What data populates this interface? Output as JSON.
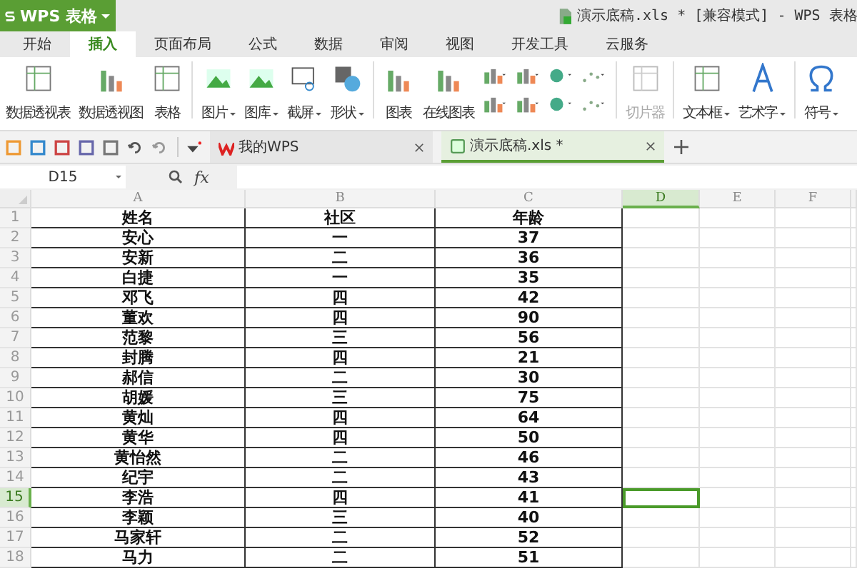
{
  "app_button": {
    "label": "WPS 表格"
  },
  "window": {
    "title": "演示底稿.xls * [兼容模式] - WPS 表格"
  },
  "tabs": [
    {
      "label": "开始",
      "selected": false
    },
    {
      "label": "插入",
      "selected": true
    },
    {
      "label": "页面布局",
      "selected": false
    },
    {
      "label": "公式",
      "selected": false
    },
    {
      "label": "数据",
      "selected": false
    },
    {
      "label": "审阅",
      "selected": false
    },
    {
      "label": "视图",
      "selected": false
    },
    {
      "label": "开发工具",
      "selected": false
    },
    {
      "label": "云服务",
      "selected": false
    }
  ],
  "ribbon": [
    {
      "kind": "large",
      "label": "数据透视表",
      "menu": false,
      "disabled": false
    },
    {
      "kind": "large",
      "label": "数据透视图",
      "menu": false,
      "disabled": false
    },
    {
      "kind": "large",
      "label": "表格",
      "menu": false,
      "disabled": false
    },
    {
      "kind": "separator"
    },
    {
      "kind": "large",
      "label": "图片",
      "menu": true,
      "disabled": false
    },
    {
      "kind": "large",
      "label": "图库",
      "menu": true,
      "disabled": false
    },
    {
      "kind": "large",
      "label": "截屏",
      "menu": true,
      "disabled": false
    },
    {
      "kind": "large",
      "label": "形状",
      "menu": true,
      "disabled": false
    },
    {
      "kind": "separator"
    },
    {
      "kind": "large",
      "label": "图表",
      "menu": false,
      "disabled": false
    },
    {
      "kind": "large",
      "label": "在线图表",
      "menu": false,
      "disabled": false
    },
    {
      "kind": "small_grid"
    },
    {
      "kind": "separator"
    },
    {
      "kind": "large",
      "label": "切片器",
      "menu": false,
      "disabled": true
    },
    {
      "kind": "separator"
    },
    {
      "kind": "large",
      "label": "文本框",
      "menu": true,
      "disabled": false
    },
    {
      "kind": "large",
      "label": "艺术字",
      "menu": true,
      "disabled": false
    },
    {
      "kind": "separator"
    },
    {
      "kind": "large",
      "label": "符号",
      "menu": true,
      "disabled": false
    }
  ],
  "doc_tabs": [
    {
      "label": "我的WPS",
      "selected": false
    },
    {
      "label": "演示底稿.xls *",
      "selected": true
    }
  ],
  "name_box": {
    "value": "D15"
  },
  "formula_bar": {
    "fx": "fx"
  },
  "columns": [
    {
      "label": "A",
      "selected": false
    },
    {
      "label": "B",
      "selected": false
    },
    {
      "label": "C",
      "selected": false
    },
    {
      "label": "D",
      "selected": true
    },
    {
      "label": "E",
      "selected": false
    },
    {
      "label": "F",
      "selected": false
    }
  ],
  "rows": [
    {
      "number": "1",
      "selected": false,
      "cells": [
        "姓名",
        "社区",
        "年龄"
      ]
    },
    {
      "number": "2",
      "selected": false,
      "cells": [
        "安心",
        "一",
        "37"
      ]
    },
    {
      "number": "3",
      "selected": false,
      "cells": [
        "安新",
        "二",
        "36"
      ]
    },
    {
      "number": "4",
      "selected": false,
      "cells": [
        "白捷",
        "一",
        "35"
      ]
    },
    {
      "number": "5",
      "selected": false,
      "cells": [
        "邓飞",
        "四",
        "42"
      ]
    },
    {
      "number": "6",
      "selected": false,
      "cells": [
        "董欢",
        "四",
        "90"
      ]
    },
    {
      "number": "7",
      "selected": false,
      "cells": [
        "范黎",
        "三",
        "56"
      ]
    },
    {
      "number": "8",
      "selected": false,
      "cells": [
        "封腾",
        "四",
        "21"
      ]
    },
    {
      "number": "9",
      "selected": false,
      "cells": [
        "郝信",
        "二",
        "30"
      ]
    },
    {
      "number": "10",
      "selected": false,
      "cells": [
        "胡媛",
        "三",
        "75"
      ]
    },
    {
      "number": "11",
      "selected": false,
      "cells": [
        "黄灿",
        "四",
        "64"
      ]
    },
    {
      "number": "12",
      "selected": false,
      "cells": [
        "黄华",
        "四",
        "50"
      ]
    },
    {
      "number": "13",
      "selected": false,
      "cells": [
        "黄怡然",
        "二",
        "46"
      ]
    },
    {
      "number": "14",
      "selected": false,
      "cells": [
        "纪宇",
        "二",
        "43"
      ]
    },
    {
      "number": "15",
      "selected": true,
      "cells": [
        "李浩",
        "四",
        "41"
      ]
    },
    {
      "number": "16",
      "selected": false,
      "cells": [
        "李颖",
        "三",
        "40"
      ]
    },
    {
      "number": "17",
      "selected": false,
      "cells": [
        "马家轩",
        "二",
        "52"
      ]
    },
    {
      "number": "18",
      "selected": false,
      "cells": [
        "马力",
        "二",
        "51"
      ]
    }
  ]
}
